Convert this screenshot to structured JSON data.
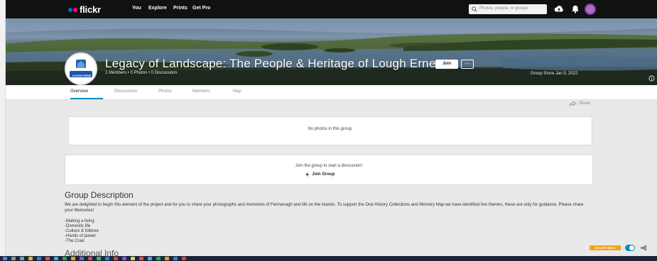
{
  "nav": {
    "logo": "flickr",
    "links": [
      "You",
      "Explore",
      "Prints",
      "Get Pro"
    ],
    "search_placeholder": "Photos, people, or groups"
  },
  "group": {
    "logo_text": "LOUGH ERNE",
    "title": "Legacy of Landscape: The People & Heritage of Lough Erne",
    "stats": "1 Members  •  0 Photos  •  0 Discussions",
    "join_label": "Join",
    "more_label": "···",
    "since": "Group Since Jan 5, 2022"
  },
  "tabs": [
    "Overview",
    "Discussions",
    "Photos",
    "Members",
    "Map"
  ],
  "content": {
    "share_label": "Share",
    "no_photos": "No photos in this group.",
    "discussion_prompt": "Join the group to start a discussion!",
    "join_group_label": "Join Group"
  },
  "description": {
    "heading": "Group Description",
    "body": "We are delighted to begin this element of the project and for you to share your photographs and memories of Fermanagh and life on the islands. To support the Oral History Collections and Memory Map we have identified five themes, these are only for guidance. Please share your Memories!",
    "themes": [
      "-Making a living",
      "-Domestic life",
      "-Culture & folklore",
      "-Hands of power",
      "-The Craic"
    ]
  },
  "additional_heading": "Additional Info",
  "footer": {
    "groups_beta_label": "GROUPS BETA"
  },
  "colors": {
    "flickr_blue": "#0063dc",
    "flickr_pink": "#ff0084",
    "accent": "#008ecc",
    "beta_orange": "#f5a31a"
  }
}
